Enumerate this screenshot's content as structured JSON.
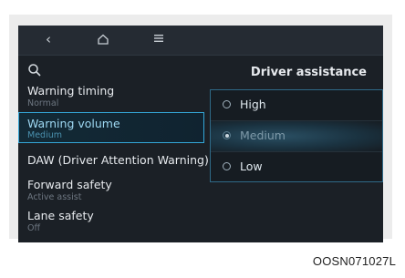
{
  "topbar": {
    "back_icon": "chevron-left-icon",
    "home_icon": "home-icon",
    "menu_icon": "menu-icon"
  },
  "left_panel": {
    "search_icon": "search-icon",
    "items": [
      {
        "label": "Warning timing",
        "sub": "Normal"
      },
      {
        "label": "Warning volume",
        "sub": "Medium"
      },
      {
        "label": "DAW (Driver Attention Warning)",
        "sub": ""
      },
      {
        "label": "Forward safety",
        "sub": "Active assist"
      },
      {
        "label": "Lane safety",
        "sub": "Off"
      }
    ]
  },
  "right_panel": {
    "title": "Driver assistance",
    "options": [
      {
        "label": "High"
      },
      {
        "label": "Medium"
      },
      {
        "label": "Low"
      }
    ],
    "selected_option": "Medium"
  },
  "caption": "OOSN071027L",
  "colors": {
    "screen_bg": "#1b2026",
    "accent": "#34a7d8"
  }
}
